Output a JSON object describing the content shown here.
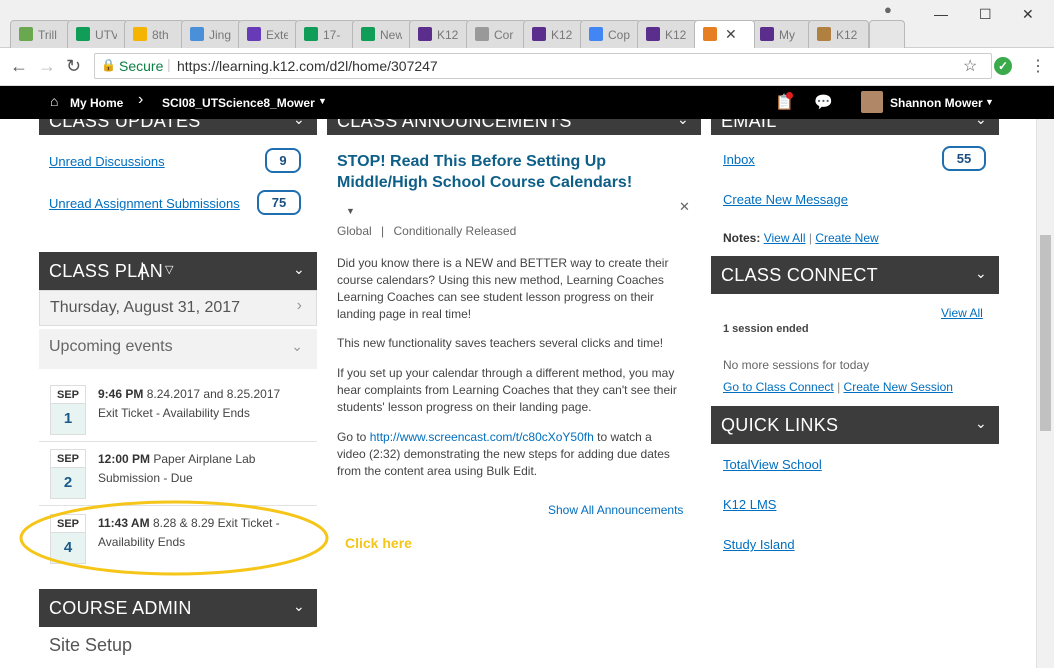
{
  "browser": {
    "tabs": [
      {
        "title": "Trill",
        "icon": "trillium-icon",
        "color": "#6aa84f"
      },
      {
        "title": "UTV",
        "icon": "sheets-icon",
        "color": "#0f9d58"
      },
      {
        "title": "8th",
        "icon": "drive-icon",
        "color": "#f4b400"
      },
      {
        "title": "Jing",
        "icon": "weebly-icon",
        "color": "#4a90d9"
      },
      {
        "title": "Exte",
        "icon": "forms-icon",
        "color": "#673ab7"
      },
      {
        "title": "17-",
        "icon": "sheets-icon",
        "color": "#0f9d58"
      },
      {
        "title": "New",
        "icon": "sheets-icon",
        "color": "#0f9d58"
      },
      {
        "title": "K12",
        "icon": "k12-icon",
        "color": "#5b2d8c"
      },
      {
        "title": "Cor",
        "icon": "page-icon",
        "color": "#999999"
      },
      {
        "title": "K12",
        "icon": "k12-icon",
        "color": "#5b2d8c"
      },
      {
        "title": "Cop",
        "icon": "docs-icon",
        "color": "#4285f4"
      },
      {
        "title": "K12",
        "icon": "k12-icon",
        "color": "#5b2d8c"
      },
      {
        "title": "",
        "icon": "d2l-icon",
        "color": "#e67e22",
        "active": true
      },
      {
        "title": "My",
        "icon": "k12-icon",
        "color": "#5b2d8c"
      },
      {
        "title": "K12",
        "icon": "k12-image-icon",
        "color": "#b08040"
      }
    ],
    "secure_label": "Secure",
    "url": "https://learning.k12.com/d2l/home/307247"
  },
  "navbar": {
    "home": "My Home",
    "course": "SCI08_UTScience8_Mower",
    "user": "Shannon Mower"
  },
  "class_updates": {
    "title": "CLASS UPDATES",
    "unread_discussions_label": "Unread Discussions",
    "unread_discussions_count": "9",
    "unread_submissions_label": "Unread Assignment Submissions",
    "unread_submissions_count": "75"
  },
  "class_plan": {
    "title": "CLASS PLAN",
    "date": "Thursday, August 31, 2017",
    "upcoming": "Upcoming events",
    "events": [
      {
        "month": "SEP",
        "day": "1",
        "time": "9:46 PM",
        "title_line1": "8.24.2017 and 8.25.2017",
        "title_line2": "Exit Ticket - Availability Ends"
      },
      {
        "month": "SEP",
        "day": "2",
        "time": "12:00 PM",
        "title_line1": "Paper Airplane Lab",
        "title_line2": "Submission - Due"
      },
      {
        "month": "SEP",
        "day": "4",
        "time": "11:43 AM",
        "title_line1": "8.28 & 8.29 Exit Ticket -",
        "title_line2": "Availability Ends"
      }
    ],
    "annotation": "Click here",
    "annotation_color": "#f5c518"
  },
  "course_admin": {
    "title": "COURSE ADMIN",
    "site_setup": "Site Setup"
  },
  "announcements": {
    "title": "CLASS ANNOUNCEMENTS",
    "heading_line1": "STOP! Read This Before Setting Up",
    "heading_line2": "Middle/High School Course Calendars!",
    "meta_global": "Global",
    "meta_release": "Conditionally Released",
    "p1": "Did you know there is a NEW and BETTER way to create their course calendars? Using this new method, Learning Coaches Learning Coaches can see student lesson progress on their landing page in real time!",
    "p2": "This new functionality saves teachers several clicks and time!",
    "p3": "If you set up your calendar through a different method, you may hear complaints from Learning Coaches that they can't see their students' lesson progress on their landing page.",
    "p4_pre": "Go to ",
    "p4_link": "http://www.screencast.com/t/c80cXoY50fh",
    "p4_post": " to watch a video (2:32) demonstrating the new steps for adding due dates from the content area using Bulk Edit.",
    "show_all": "Show All Announcements"
  },
  "email": {
    "title": "EMAIL",
    "inbox": "Inbox",
    "inbox_count": "55",
    "create_message": "Create New Message",
    "notes_label": "Notes:",
    "view_all": "View All",
    "create_new": "Create New"
  },
  "class_connect": {
    "title": "CLASS CONNECT",
    "view_all": "View All",
    "sessions_ended": "1 session ended",
    "no_more": "No more sessions for today",
    "go_to": "Go to Class Connect",
    "create_session": "Create New Session"
  },
  "quick_links": {
    "title": "QUICK LINKS",
    "links": [
      "TotalView School",
      "K12 LMS",
      "Study Island"
    ]
  }
}
